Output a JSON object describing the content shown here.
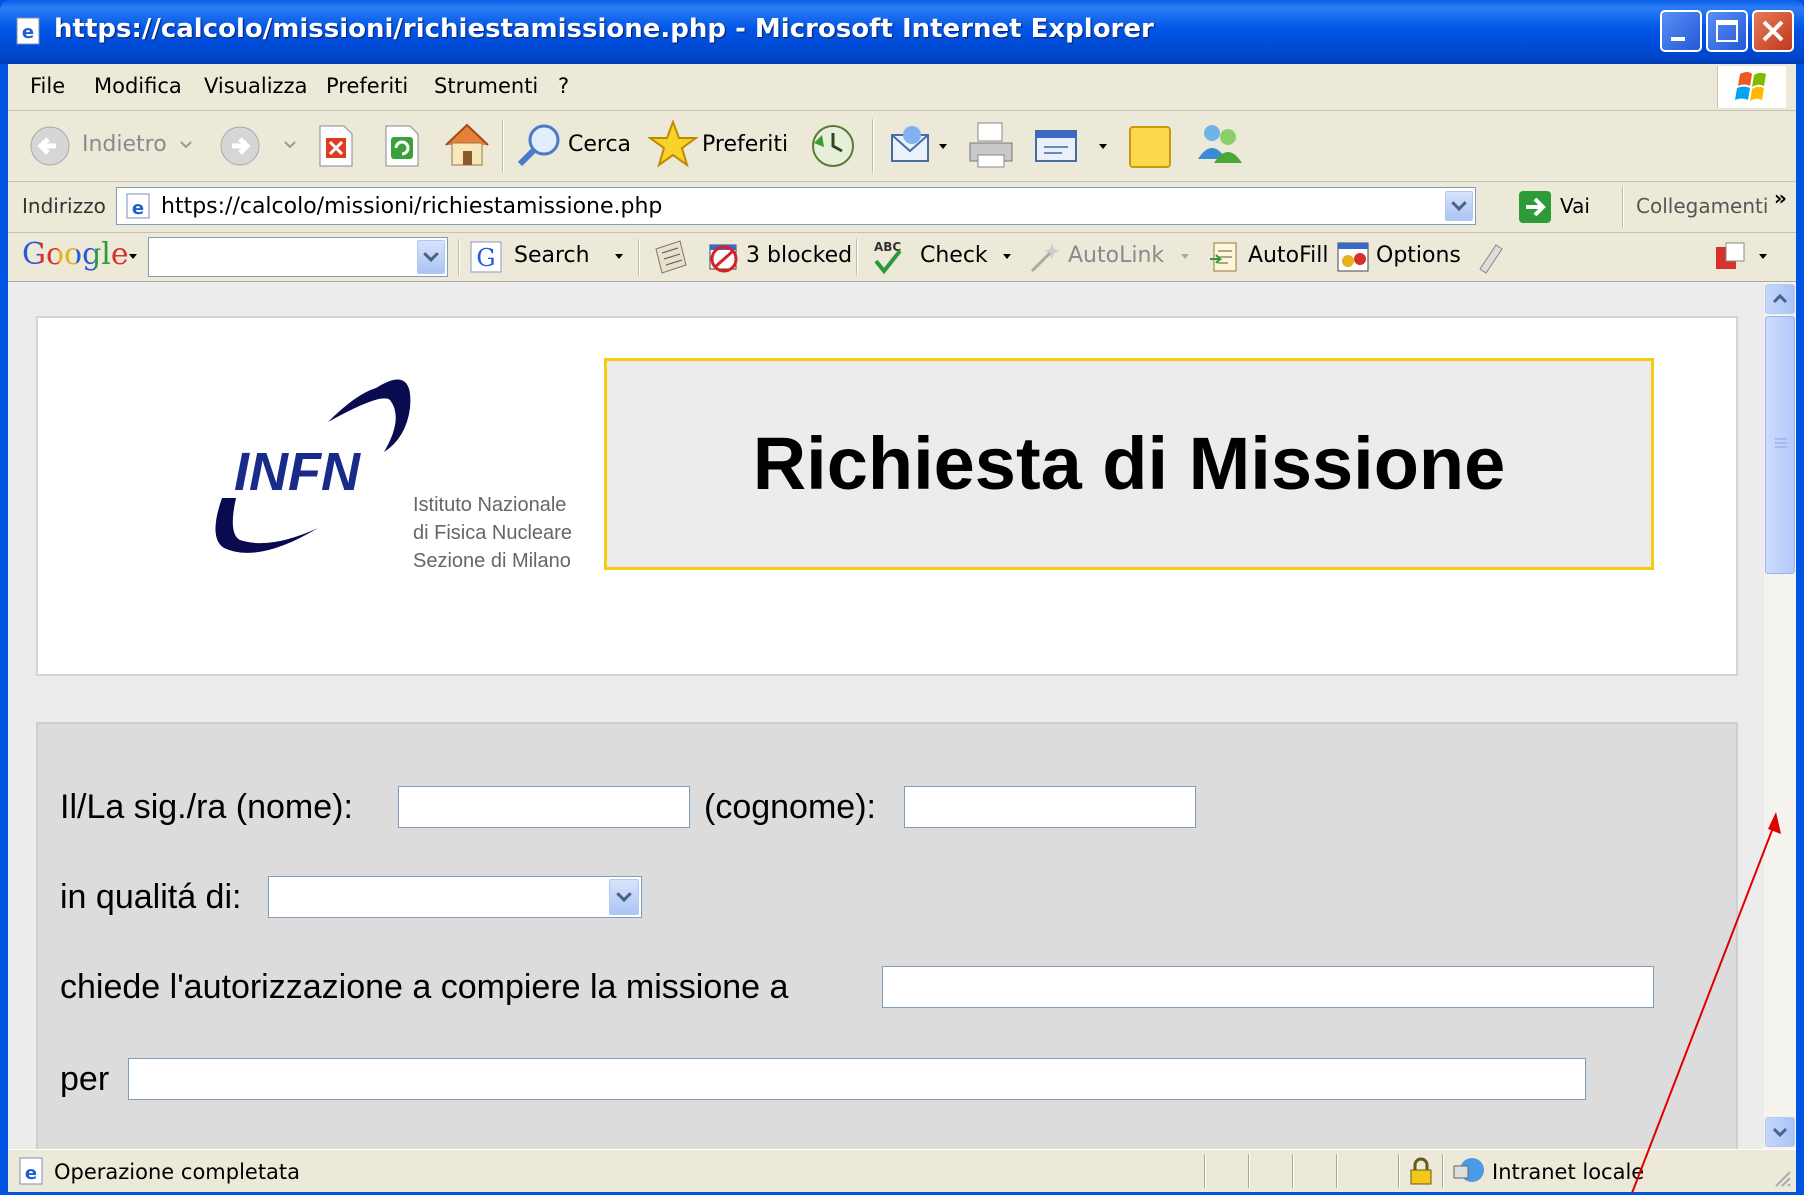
{
  "window": {
    "title": "https://calcolo/missioni/richiestamissione.php - Microsoft Internet Explorer"
  },
  "menu": [
    "File",
    "Modifica",
    "Visualizza",
    "Preferiti",
    "Strumenti",
    "?"
  ],
  "toolbar": {
    "back_label": "Indietro",
    "search_label": "Cerca",
    "favorites_label": "Preferiti"
  },
  "address": {
    "label": "Indirizzo",
    "url": "https://calcolo/missioni/richiestamissione.php",
    "go_label": "Vai",
    "links_label": "Collegamenti"
  },
  "google": {
    "logo": "Google",
    "search_label": "Search",
    "blocked_label": "3 blocked",
    "check_label": "Check",
    "autolink_label": "AutoLink",
    "autofill_label": "AutoFill",
    "options_label": "Options"
  },
  "header": {
    "logo_text": "INFN",
    "org_lines": [
      "Istituto Nazionale",
      "di Fisica Nucleare",
      "Sezione di Milano"
    ],
    "title": "Richiesta di Missione"
  },
  "form": {
    "name_label": "Il/La sig./ra (nome):",
    "surname_label": "(cognome):",
    "role_label": "in qualitá di:",
    "destination_label": "chiede l'autorizzazione a compiere la missione a",
    "purpose_label": "per",
    "name_value": "",
    "surname_value": "",
    "role_value": "",
    "destination_value": "",
    "purpose_value": ""
  },
  "status": {
    "text": "Operazione completata",
    "zone": "Intranet locale"
  },
  "colors": {
    "titlebar": "#0054e3",
    "chrome": "#ece9d8",
    "title_box_border": "#f5cc11",
    "annotation_arrow": "#e00000"
  }
}
